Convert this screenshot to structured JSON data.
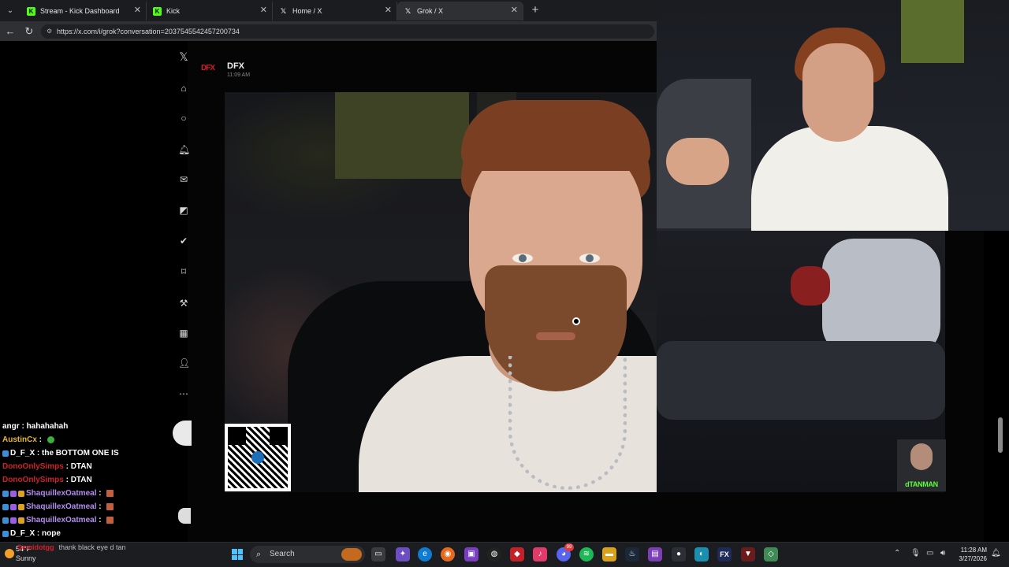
{
  "browser": {
    "tabs": [
      {
        "label": "Stream - Kick Dashboard",
        "icon": "kick-icon"
      },
      {
        "label": "Kick",
        "icon": "kick-icon"
      },
      {
        "label": "Home / X",
        "icon": "x-icon"
      },
      {
        "label": "Grok / X",
        "icon": "x-icon"
      }
    ],
    "new_tab": "+",
    "url": "https://x.com/i/grok?conversation=2037545542457200734"
  },
  "dm": {
    "logo": "DFX",
    "name": "DFX",
    "time": "11:09 AM"
  },
  "chat": [
    {
      "user": "angr",
      "message": "hahahahah",
      "color": "#ffffff",
      "badges": 0,
      "emote": false
    },
    {
      "user": "AustinCx",
      "message": "",
      "color": "#e8b72b",
      "badges": 0,
      "emote": true
    },
    {
      "user": "D_F_X",
      "message": "the BOTTOM ONE IS",
      "color": "#ffffff",
      "badges": 1,
      "emote": false
    },
    {
      "user": "DonoOnlySimps",
      "message": "DTAN",
      "color": "#d0202a",
      "badges": 0,
      "emote": false
    },
    {
      "user": "DonoOnlySimps",
      "message": "DTAN",
      "color": "#d0202a",
      "badges": 0,
      "emote": false
    },
    {
      "user": "ShaquillexOatmeal",
      "message": "",
      "color": "#b58cf0",
      "badges": 3,
      "emote": true
    },
    {
      "user": "ShaquillexOatmeal",
      "message": "",
      "color": "#b58cf0",
      "badges": 3,
      "emote": true
    },
    {
      "user": "ShaquillexOatmeal",
      "message": "",
      "color": "#b58cf0",
      "badges": 3,
      "emote": true
    },
    {
      "user": "D_F_X",
      "message": "nope",
      "color": "#ffffff",
      "badges": 1,
      "emote": false
    }
  ],
  "chat_ghost": {
    "user": "Semidotgg",
    "message": "thank black eye d tan"
  },
  "cam_label": "dTANMAN",
  "taskbar": {
    "weather_temp": "54°F",
    "weather_desc": "Sunny",
    "search_placeholder": "Search",
    "time": "11:28 AM",
    "date": "3/27/2026",
    "discord_badge": "99"
  },
  "colors": {
    "kick_green": "#53fc18",
    "dfx_red": "#c8202a",
    "taskbar": "#1c1d21"
  }
}
